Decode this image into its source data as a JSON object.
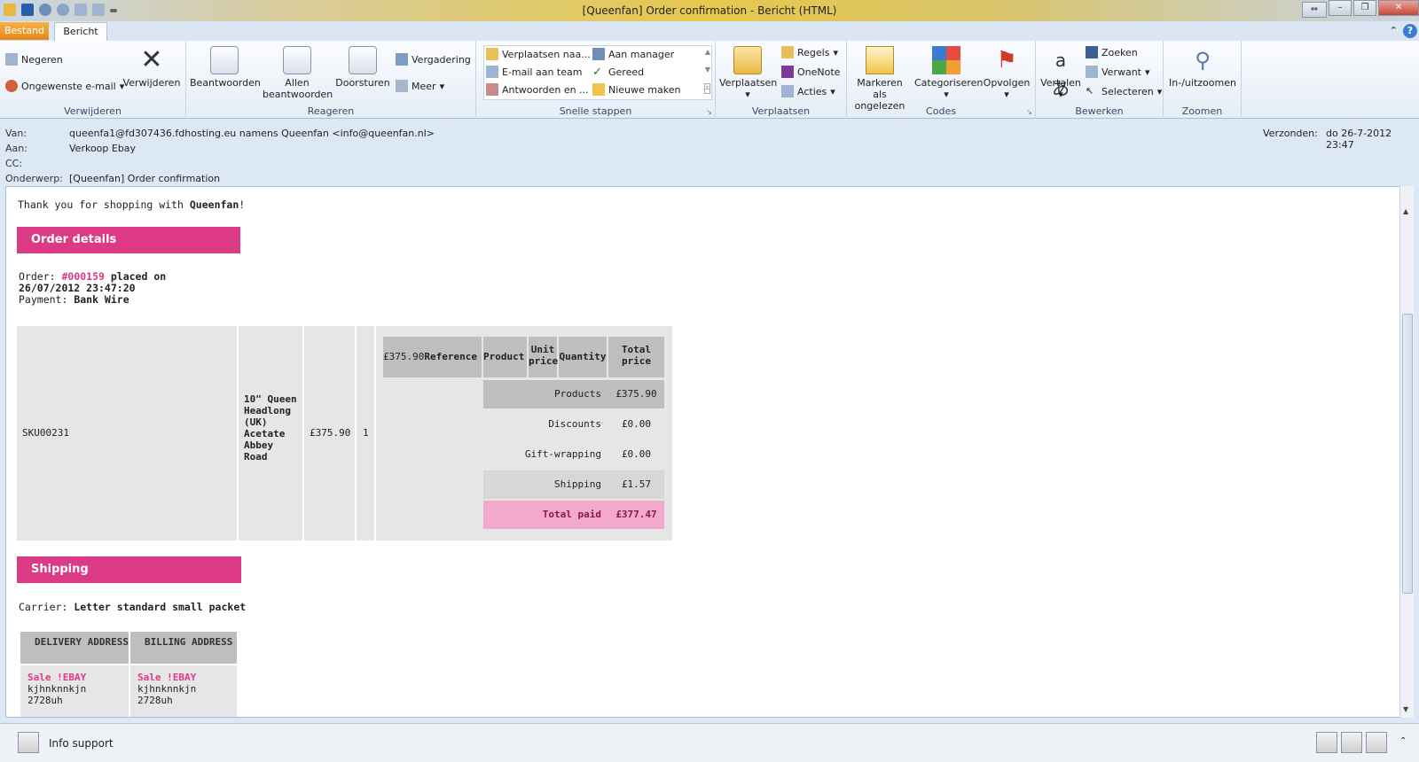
{
  "window": {
    "title": "[Queenfan] Order confirmation  -  Bericht (HTML)"
  },
  "tabs": {
    "file": "Bestand",
    "message": "Bericht"
  },
  "ribbon": {
    "delete_group": {
      "label": "Verwijderen",
      "ignore": "Negeren",
      "junk": "Ongewenste e-mail",
      "delete": "Verwijderen"
    },
    "respond_group": {
      "label": "Reageren",
      "reply": "Beantwoorden",
      "reply_all": "Allen beantwoorden",
      "forward": "Doorsturen",
      "meeting": "Vergadering",
      "more": "Meer"
    },
    "quick_steps": {
      "label": "Snelle stappen",
      "items": [
        "Verplaatsen naa...",
        "Aan manager",
        "E-mail aan team",
        "Gereed",
        "Antwoorden en ...",
        "Nieuwe maken"
      ]
    },
    "move_group": {
      "label": "Verplaatsen",
      "move": "Verplaatsen",
      "rules": "Regels",
      "onenote": "OneNote",
      "actions": "Acties"
    },
    "tags_group": {
      "label": "Codes",
      "mark_unread": "Markeren als ongelezen",
      "categorize": "Categoriseren",
      "follow_up": "Opvolgen"
    },
    "edit_group": {
      "label": "Bewerken",
      "translate": "Vertalen",
      "find": "Zoeken",
      "related": "Verwant",
      "select": "Selecteren"
    },
    "zoom_group": {
      "label": "Zoomen",
      "zoom": "In-/uitzoomen"
    }
  },
  "header": {
    "from_label": "Van:",
    "from_value": "queenfa1@fd307436.fdhosting.eu namens Queenfan <info@queenfan.nl>",
    "to_label": "Aan:",
    "to_value": "Verkoop Ebay",
    "cc_label": "CC:",
    "cc_value": "",
    "subject_label": "Onderwerp:",
    "subject_value": "[Queenfan] Order confirmation",
    "sent_label": "Verzonden:",
    "sent_value": "do 26-7-2012 23:47"
  },
  "email": {
    "thanks_prefix": "Thank you for shopping with ",
    "shop_name": "Queenfan",
    "thanks_suffix": "!",
    "order_details_title": "Order details",
    "order_label": "Order: ",
    "order_number": "#000159",
    "placed_on": " placed on",
    "order_date": "26/07/2012 23:47:20",
    "payment_label": "Payment: ",
    "payment_value": "Bank Wire",
    "item": {
      "sku": "SKU00231",
      "name": "10\" Queen Headlong (UK) Acetate Abbey Road",
      "price": "£375.90",
      "qty": "1"
    },
    "table_headers": {
      "first": "£375.90",
      "reference": "Reference",
      "product": "Product",
      "unit_price": "Unit price",
      "quantity": "Quantity",
      "total_price": "Total price"
    },
    "totals": [
      {
        "label": "Products",
        "value": "£375.90"
      },
      {
        "label": "Discounts",
        "value": "£0.00"
      },
      {
        "label": "Gift-wrapping",
        "value": "£0.00"
      },
      {
        "label": "Shipping",
        "value": "£1.57"
      },
      {
        "label": "Total paid",
        "value": "£377.47"
      }
    ],
    "shipping_title": "Shipping",
    "carrier_label": "Carrier: ",
    "carrier_value": "Letter standard small packet",
    "delivery_header": "DELIVERY ADDRESS",
    "billing_header": "BILLING ADDRESS",
    "delivery_name": "Sale !EBAY",
    "delivery_line1": "kjhnknnkjn",
    "delivery_line2": "2728uh",
    "billing_name": "Sale !EBAY",
    "billing_line1": "kjhnknnkjn",
    "billing_line2": "2728uh"
  },
  "status": {
    "contact": "Info support"
  },
  "colors": {
    "accent": "#dd3a86",
    "file_tab": "#e6861a",
    "total_row": "#f2a9cb"
  }
}
